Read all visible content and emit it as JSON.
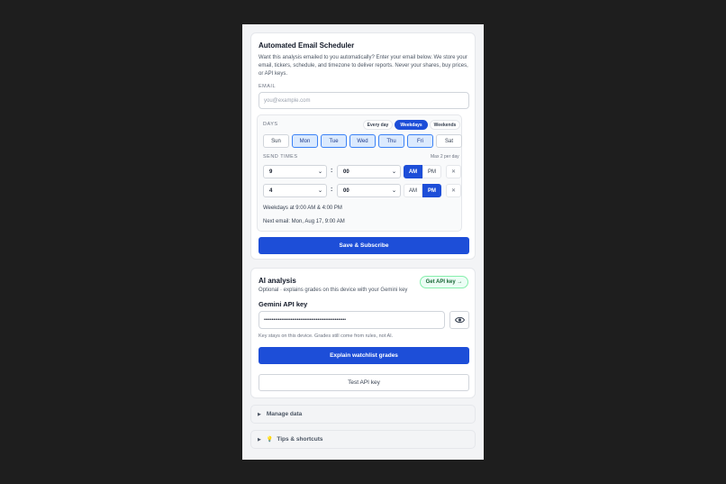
{
  "scheduler": {
    "title": "Automated Email Scheduler",
    "description": "Want this analysis emailed to you automatically? Enter your email below. We store your email, tickers, schedule, and timezone to deliver reports. Never your shares, buy prices, or API keys.",
    "email_label": "EMAIL",
    "email_placeholder": "you@example.com",
    "days_label": "DAYS",
    "presets": [
      "Every day",
      "Weekdays",
      "Weekends"
    ],
    "selected_preset": "Weekdays",
    "days": [
      "Sun",
      "Mon",
      "Tue",
      "Wed",
      "Thu",
      "Fri",
      "Sat"
    ],
    "send_times_label": "SEND TIMES",
    "max_note": "Max 2 per day",
    "times": [
      {
        "hour": "9",
        "minute": "00",
        "period": "AM"
      },
      {
        "hour": "4",
        "minute": "00",
        "period": "PM"
      }
    ],
    "am_label": "AM",
    "pm_label": "PM",
    "remove_glyph": "✕",
    "summary": "Weekdays at 9:00 AM & 4:00 PM",
    "next_email": "Next email: Mon, Aug 17, 9:00 AM",
    "save_button": "Save & Subscribe"
  },
  "ai": {
    "title": "AI analysis",
    "subtitle": "Optional · explains grades on this device with your Gemini key",
    "get_key_button": "Get API key →",
    "key_label": "Gemini API key",
    "key_value": "••••••••••••••••••••••••••••••••••••••••••••••••••••",
    "key_note": "Key stays on this device. Grades still come from rules, not AI.",
    "explain_button": "Explain watchlist grades",
    "test_button": "Test API key"
  },
  "sections": {
    "manage_data": "Manage data",
    "tips": "Tips & shortcuts"
  },
  "icons": {
    "eye": "eye-icon",
    "bulb": "lightbulb-icon",
    "triangle": "triangle-right-icon"
  },
  "colors": {
    "primary": "#1d4ed8",
    "selected_day_bg": "#dbeafe"
  }
}
